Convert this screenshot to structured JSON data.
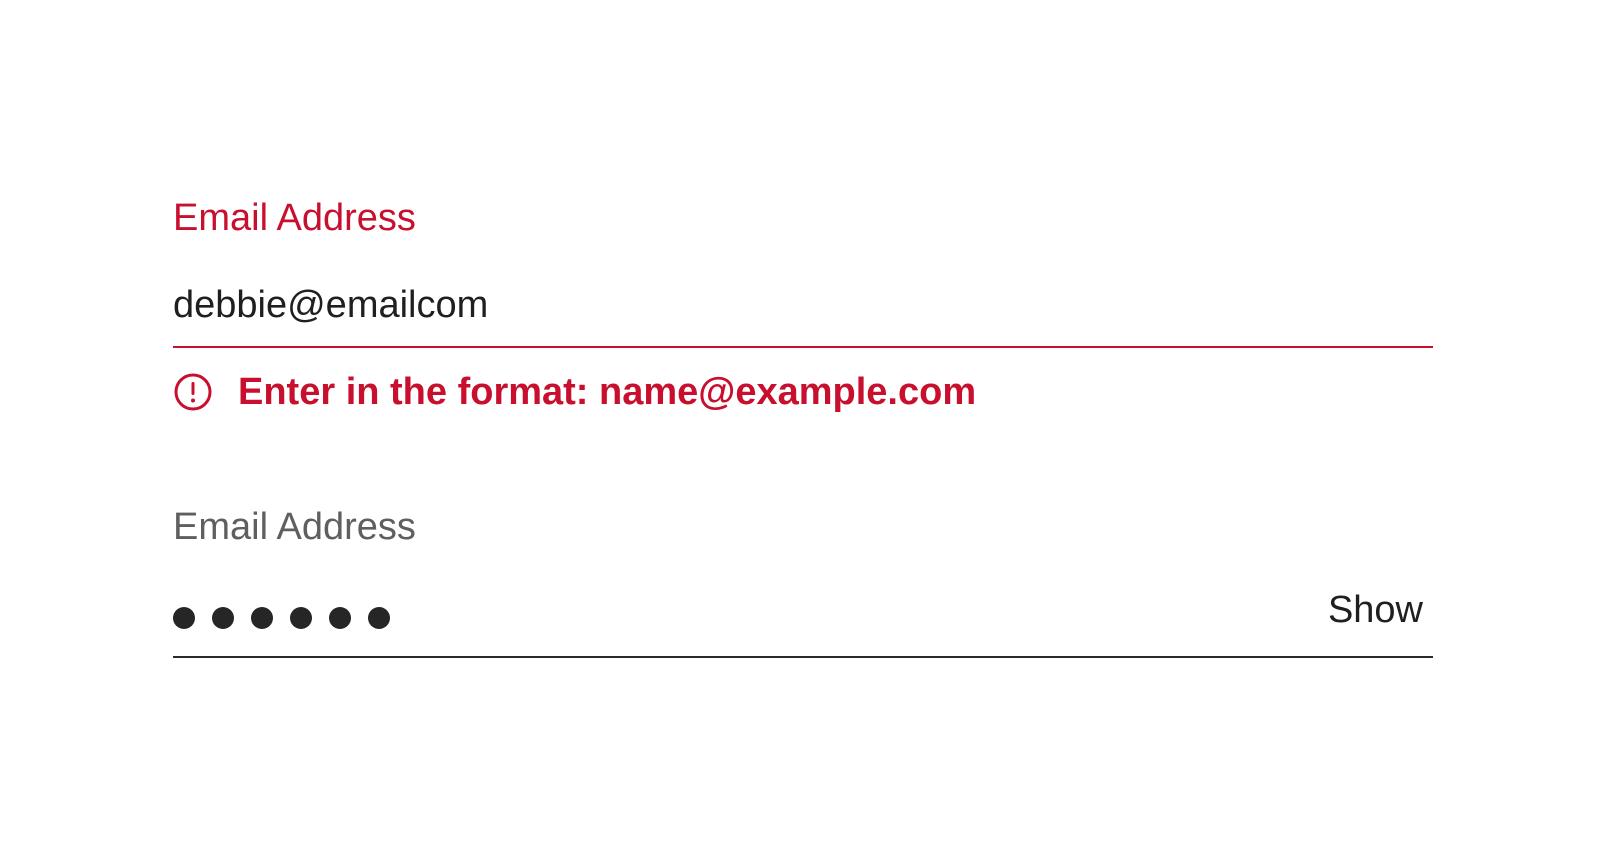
{
  "email_field": {
    "label": "Email Address",
    "value": "debbie@emailcom",
    "error_message": "Enter in the format: name@example.com",
    "state_color": "#c8102e",
    "error_icon": "alert-circle-icon"
  },
  "password_field": {
    "label": "Email Address",
    "masked_length": 6,
    "toggle_label": "Show"
  }
}
